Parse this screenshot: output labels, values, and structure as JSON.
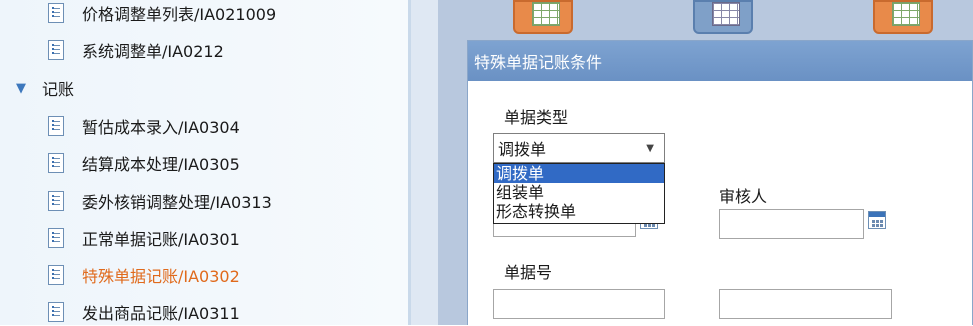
{
  "sidebar": {
    "items": [
      {
        "label": "价格调整单列表/IA021009",
        "type": "leaf"
      },
      {
        "label": "系统调整单/IA0212",
        "type": "leaf"
      },
      {
        "label": "记账",
        "type": "group"
      },
      {
        "label": "暂估成本录入/IA0304",
        "type": "leaf"
      },
      {
        "label": "结算成本处理/IA0305",
        "type": "leaf"
      },
      {
        "label": "委外核销调整处理/IA0313",
        "type": "leaf"
      },
      {
        "label": "正常单据记账/IA0301",
        "type": "leaf"
      },
      {
        "label": "特殊单据记账/IA0302",
        "type": "leaf",
        "active": true
      },
      {
        "label": "发出商品记账/IA0311",
        "type": "leaf"
      }
    ]
  },
  "dialog": {
    "title": "特殊单据记账条件",
    "doc_type_label": "单据类型",
    "doc_type_value": "调拨单",
    "doc_type_options": [
      "调拨单",
      "组装单",
      "形态转换单"
    ],
    "reviewer_label": "审核人",
    "doc_no_label": "单据号"
  },
  "colors": {
    "accent": "#316ac5",
    "active_text": "#e06a1c",
    "title_bar": "#6a91c4"
  }
}
